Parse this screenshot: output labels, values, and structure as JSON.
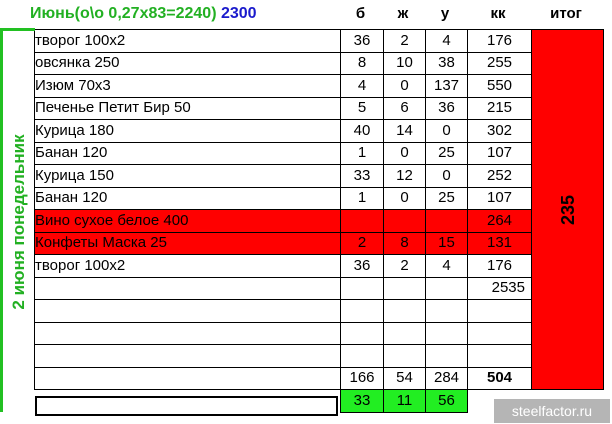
{
  "header": {
    "title_main": "Июнь(о\\о 0,27х83=2240)",
    "title_blue": "2300",
    "col_b": "б",
    "col_zh": "ж",
    "col_u": "у",
    "col_kk": "кк",
    "col_itog": "итог"
  },
  "day_label": "2 июня понедельник",
  "total_label": "235",
  "rows": [
    {
      "food": "творог 100х2",
      "b": "36",
      "zh": "2",
      "u": "4",
      "kk": "176"
    },
    {
      "food": "овсянка 250",
      "b": "8",
      "zh": "10",
      "u": "38",
      "kk": "255"
    },
    {
      "food": "Изюм 70х3",
      "b": "4",
      "zh": "0",
      "u": "137",
      "kk": "550"
    },
    {
      "food": "Печенье Петит Бир 50",
      "b": "5",
      "zh": "6",
      "u": "36",
      "kk": "215"
    },
    {
      "food": "Курица 180",
      "b": "40",
      "zh": "14",
      "u": "0",
      "kk": "302"
    },
    {
      "food": "Банан 120",
      "b": "1",
      "zh": "0",
      "u": "25",
      "kk": "107"
    },
    {
      "food": "Курица 150",
      "b": "33",
      "zh": "12",
      "u": "0",
      "kk": "252"
    },
    {
      "food": "Банан 120",
      "b": "1",
      "zh": "0",
      "u": "25",
      "kk": "107"
    },
    {
      "food": "Вино сухое белое 400",
      "b": "",
      "zh": "",
      "u": "",
      "kk": "264"
    },
    {
      "food": "Конфеты Маска 25",
      "b": "2",
      "zh": "8",
      "u": "15",
      "kk": "131"
    },
    {
      "food": "творог 100х2",
      "b": "36",
      "zh": "2",
      "u": "4",
      "kk": "176"
    },
    {
      "food": "",
      "b": "",
      "zh": "",
      "u": "",
      "kk": "2535"
    },
    {
      "food": "",
      "b": "",
      "zh": "",
      "u": "",
      "kk": ""
    },
    {
      "food": "",
      "b": "",
      "zh": "",
      "u": "",
      "kk": ""
    },
    {
      "food": "",
      "b": "",
      "zh": "",
      "u": "",
      "kk": ""
    },
    {
      "food": "",
      "b": "166",
      "zh": "54",
      "u": "284",
      "kk": "504"
    },
    {
      "food": "",
      "b": "33",
      "zh": "11",
      "u": "56",
      "kk": ""
    }
  ],
  "watermark": "steelfactor.ru",
  "colors": {
    "green_text": "#22b022",
    "blue_text": "#1a1acc",
    "red_fill": "#ff0000",
    "green_fill": "#22ee22"
  }
}
